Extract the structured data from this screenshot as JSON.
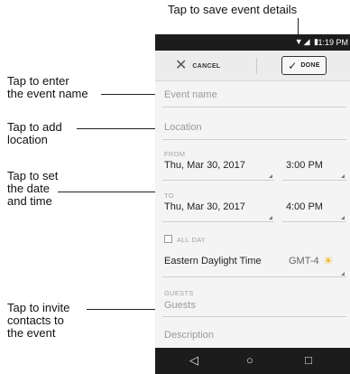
{
  "callouts": {
    "save": "Tap to save event details",
    "name": [
      "Tap to enter",
      "the event name"
    ],
    "location": [
      "Tap to add",
      "location"
    ],
    "datetime": [
      "Tap to set",
      "the date",
      "and time"
    ],
    "invite": [
      "Tap to invite",
      "contacts to",
      "the event"
    ]
  },
  "phone": {
    "status_icons": "▼◢ ▮",
    "status_time": "1:19 PM",
    "toolbar": {
      "cancel_label": "CANCEL",
      "done_label": "DONE"
    },
    "event_name_placeholder": "Event name",
    "location_placeholder": "Location",
    "from_label": "FROM",
    "from_date": "Thu, Mar 30, 2017",
    "from_time": "3:00 PM",
    "to_label": "TO",
    "to_date": "Thu, Mar 30, 2017",
    "to_time": "4:00 PM",
    "all_day_label": "ALL DAY",
    "timezone": "Eastern Daylight Time",
    "timezone_offset": "GMT-4",
    "guests_label": "GUESTS",
    "guests_placeholder": "Guests",
    "description_placeholder": "Description",
    "nav": {
      "back": "◁",
      "home": "○",
      "recent": "□"
    },
    "colors": {
      "status_bar": "#1c1c1c",
      "toolbar": "#ececec",
      "sun": "#f2b21b"
    }
  }
}
